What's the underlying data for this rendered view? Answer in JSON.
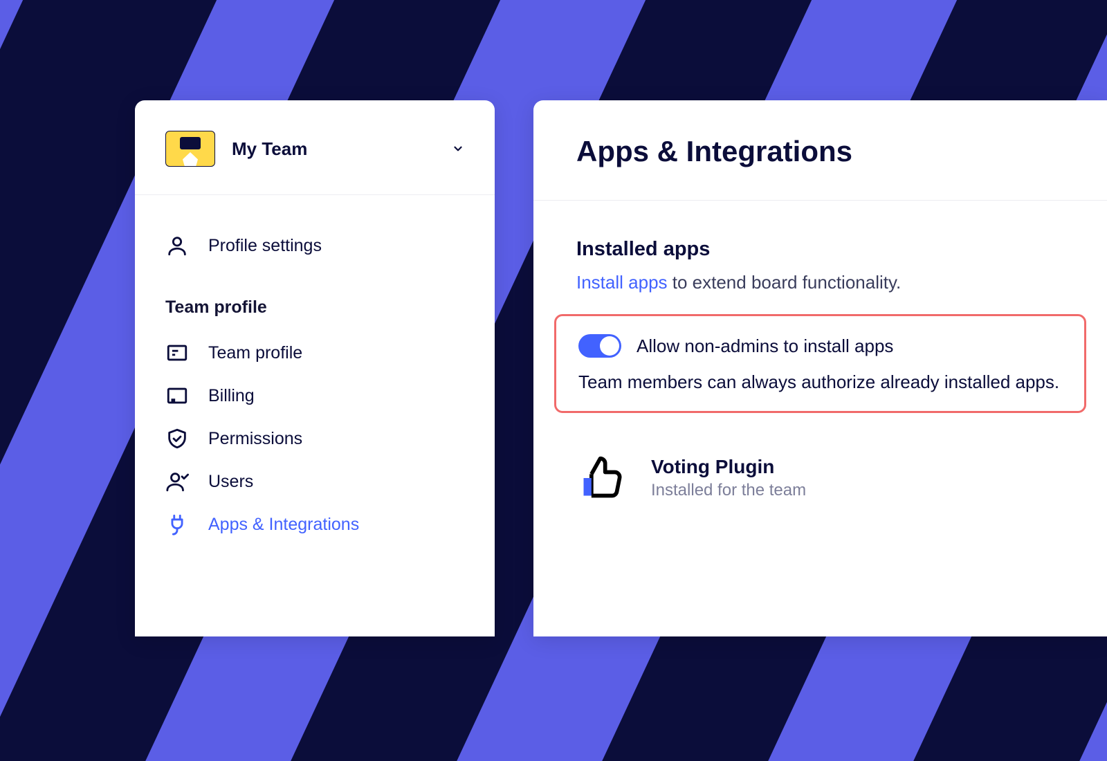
{
  "sidebar": {
    "team_name": "My Team",
    "top_item": {
      "label": "Profile settings"
    },
    "section_heading": "Team profile",
    "items": [
      {
        "label": "Team profile"
      },
      {
        "label": "Billing"
      },
      {
        "label": "Permissions"
      },
      {
        "label": "Users"
      },
      {
        "label": "Apps & Integrations",
        "active": true
      }
    ]
  },
  "main": {
    "title": "Apps & Integrations",
    "section_heading": "Installed apps",
    "subtext_link": "Install apps",
    "subtext_rest": " to extend board functionality.",
    "toggle": {
      "label": "Allow non-admins to install apps",
      "description": "Team members can always authorize already installed apps.",
      "on": true
    },
    "installed_app": {
      "name": "Voting Plugin",
      "status": "Installed for the team"
    }
  },
  "colors": {
    "accent": "#4262ff",
    "highlight_border": "#f16a6a",
    "bg_primary": "#5b5ee6",
    "bg_stripe": "#0b0d3a"
  }
}
